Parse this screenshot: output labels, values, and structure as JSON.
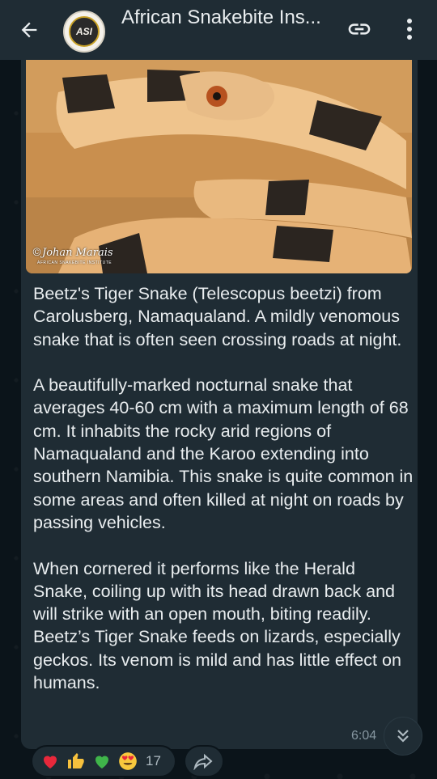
{
  "header": {
    "title": "African Snakebite Ins...",
    "avatar_text": "ASI"
  },
  "message": {
    "photo": {
      "watermark_name": "©Johan Marais",
      "watermark_org": "AFRICAN SNAKEBITE INSTITUTE"
    },
    "paragraphs": [
      "Beetz's Tiger Snake (Telescopus beetzi) from Carolusberg, Namaqualand. A mildly venomous snake that is often seen crossing roads at night.",
      "A beautifully-marked nocturnal snake that averages 40-60 cm with a maximum length of 68 cm. It inhabits the rocky arid regions of Namaqualand and the Karoo extending into southern Namibia. This snake is quite common in some areas and often killed at night on roads by passing vehicles.",
      "When cornered it performs like the Herald Snake, coiling up with its head drawn back and will strike with an open mouth, biting readily. Beetz’s Tiger Snake feeds on lizards, especially geckos. Its venom is mild and has little effect on humans."
    ],
    "time": "6:04"
  },
  "reactions": {
    "icons": [
      "red-heart-icon",
      "thumbs-up-icon",
      "green-heart-icon",
      "heart-eyes-icon"
    ],
    "count": "17"
  },
  "colors": {
    "header_bg": "#1f2c34",
    "bubble_bg": "#1f2c34",
    "chat_bg": "#0b141a",
    "text": "#e9edef",
    "muted": "#8696a0"
  }
}
